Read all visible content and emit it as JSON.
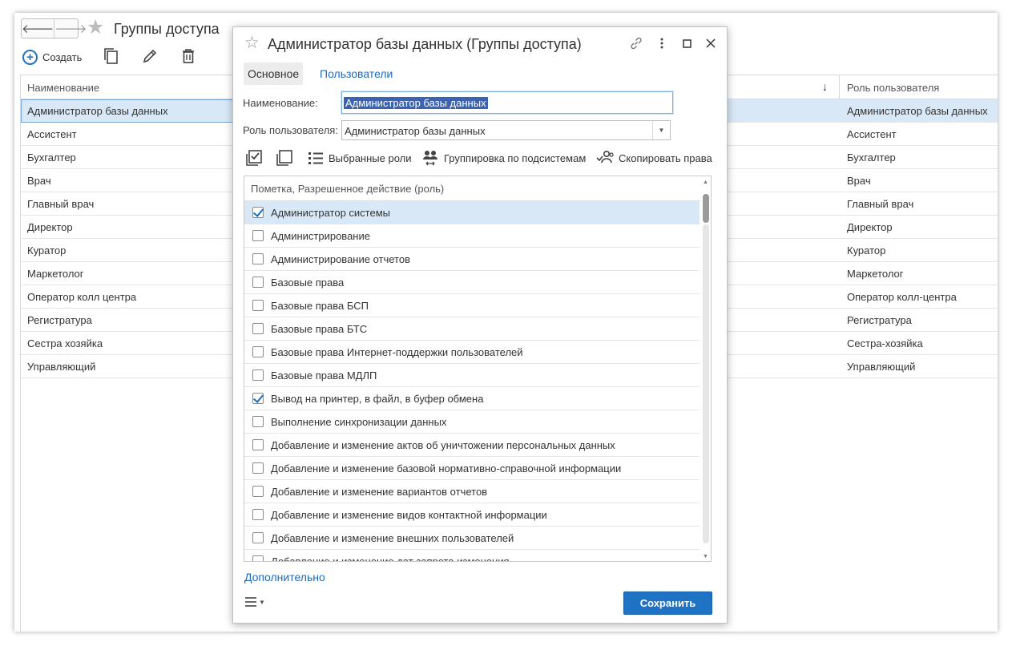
{
  "window": {
    "title": "Группы доступа",
    "nav_back": "🡐",
    "nav_forward": "🡒",
    "create_label": "Создать"
  },
  "grid": {
    "columns": [
      "Наименование",
      "Роль пользователя"
    ],
    "sort_indicator": "↓",
    "rows": [
      {
        "name": "Администратор базы данных",
        "role": "Администратор базы данных",
        "selected": true
      },
      {
        "name": "Ассистент",
        "role": "Ассистент"
      },
      {
        "name": "Бухгалтер",
        "role": "Бухгалтер"
      },
      {
        "name": "Врач",
        "role": "Врач"
      },
      {
        "name": "Главный врач",
        "role": "Главный врач"
      },
      {
        "name": "Директор",
        "role": "Директор"
      },
      {
        "name": "Куратор",
        "role": "Куратор"
      },
      {
        "name": "Маркетолог",
        "role": "Маркетолог"
      },
      {
        "name": "Оператор колл центра",
        "role": "Оператор колл-центра"
      },
      {
        "name": "Регистратура",
        "role": "Регистратура"
      },
      {
        "name": "Сестра хозяйка",
        "role": "Сестра-хозяйка"
      },
      {
        "name": "Управляющий",
        "role": "Управляющий"
      }
    ]
  },
  "modal": {
    "title": "Администратор базы данных (Группы доступа)",
    "tabs": [
      {
        "label": "Основное",
        "active": true
      },
      {
        "label": "Пользователи",
        "active": false
      }
    ],
    "name_label": "Наименование:",
    "name_value": "Администратор базы данных",
    "role_label": "Роль пользователя:",
    "role_value": "Администратор базы данных",
    "toolbar": {
      "selected_roles": "Выбранные роли",
      "group_by_subsystems": "Группировка по подсистемам",
      "copy_rights": "Скопировать права"
    },
    "list_header": "Пометка, Разрешенное действие (роль)",
    "roles": [
      {
        "label": "Администратор системы",
        "checked": true,
        "selected": true
      },
      {
        "label": "Администрирование",
        "checked": false
      },
      {
        "label": "Администрирование отчетов",
        "checked": false
      },
      {
        "label": "Базовые права",
        "checked": false
      },
      {
        "label": "Базовые права БСП",
        "checked": false
      },
      {
        "label": "Базовые права БТС",
        "checked": false
      },
      {
        "label": "Базовые права Интернет-поддержки пользователей",
        "checked": false
      },
      {
        "label": "Базовые права МДЛП",
        "checked": false
      },
      {
        "label": "Вывод на принтер, в файл, в буфер обмена",
        "checked": true
      },
      {
        "label": "Выполнение синхронизации данных",
        "checked": false
      },
      {
        "label": "Добавление и изменение актов об уничтожении персональных данных",
        "checked": false
      },
      {
        "label": "Добавление и изменение базовой нормативно-справочной информации",
        "checked": false
      },
      {
        "label": "Добавление и изменение вариантов отчетов",
        "checked": false
      },
      {
        "label": "Добавление и изменение видов контактной информации",
        "checked": false
      },
      {
        "label": "Добавление и изменение внешних пользователей",
        "checked": false
      },
      {
        "label": "Добавление и изменение дат запрета изменения",
        "checked": false
      }
    ],
    "more_link": "Дополнительно",
    "save_label": "Сохранить"
  },
  "colors": {
    "accent": "#1e73c4",
    "selection": "#d9e8f7",
    "link": "#1e6bbe"
  }
}
